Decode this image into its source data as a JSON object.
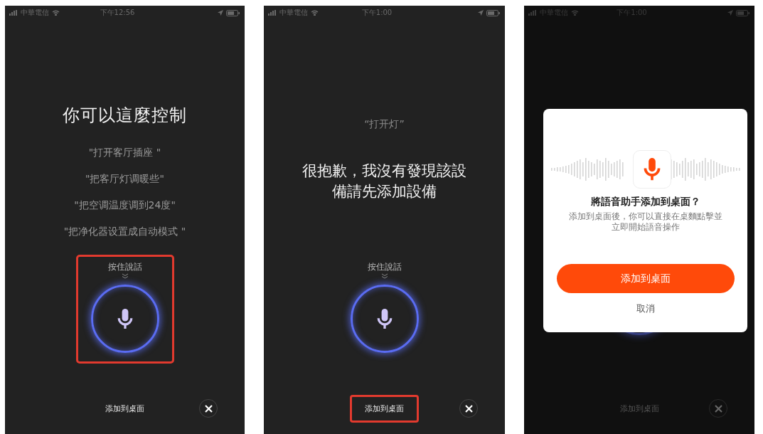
{
  "phones": [
    {
      "kind": "examples",
      "status_bar": {
        "carrier": "中華電信",
        "time": "下午12:56"
      },
      "title": "你可以這麼控制",
      "examples": [
        "\"打开客厅插座 \"",
        "\"把客厅灯调暖些\"",
        "\"把空调温度调到24度\"",
        "\"把净化器设置成自动模式 \""
      ],
      "talk_hint": "按住說話",
      "talk_highlighted": true,
      "add_button": {
        "label": "添加到桌面",
        "highlighted": false
      }
    },
    {
      "kind": "error",
      "status_bar": {
        "carrier": "中華電信",
        "time": "下午1:00"
      },
      "query": "“打开灯”",
      "message": "很抱歉，我沒有發現該設備請先添加設備",
      "talk_hint": "按住說話",
      "talk_highlighted": false,
      "add_button": {
        "label": "添加到桌面",
        "highlighted": true
      }
    },
    {
      "kind": "dialog",
      "status_bar": {
        "carrier": "中華電信",
        "time": "下午1:00"
      },
      "add_button": {
        "label": "添加到桌面",
        "highlighted": false
      },
      "dialog": {
        "title": "將語音助手添加到桌面？",
        "description": "添加到桌面後，你可以直接在桌麵點擊並立即開始語音操作",
        "confirm": "添加到桌面",
        "cancel": "取消"
      }
    }
  ]
}
